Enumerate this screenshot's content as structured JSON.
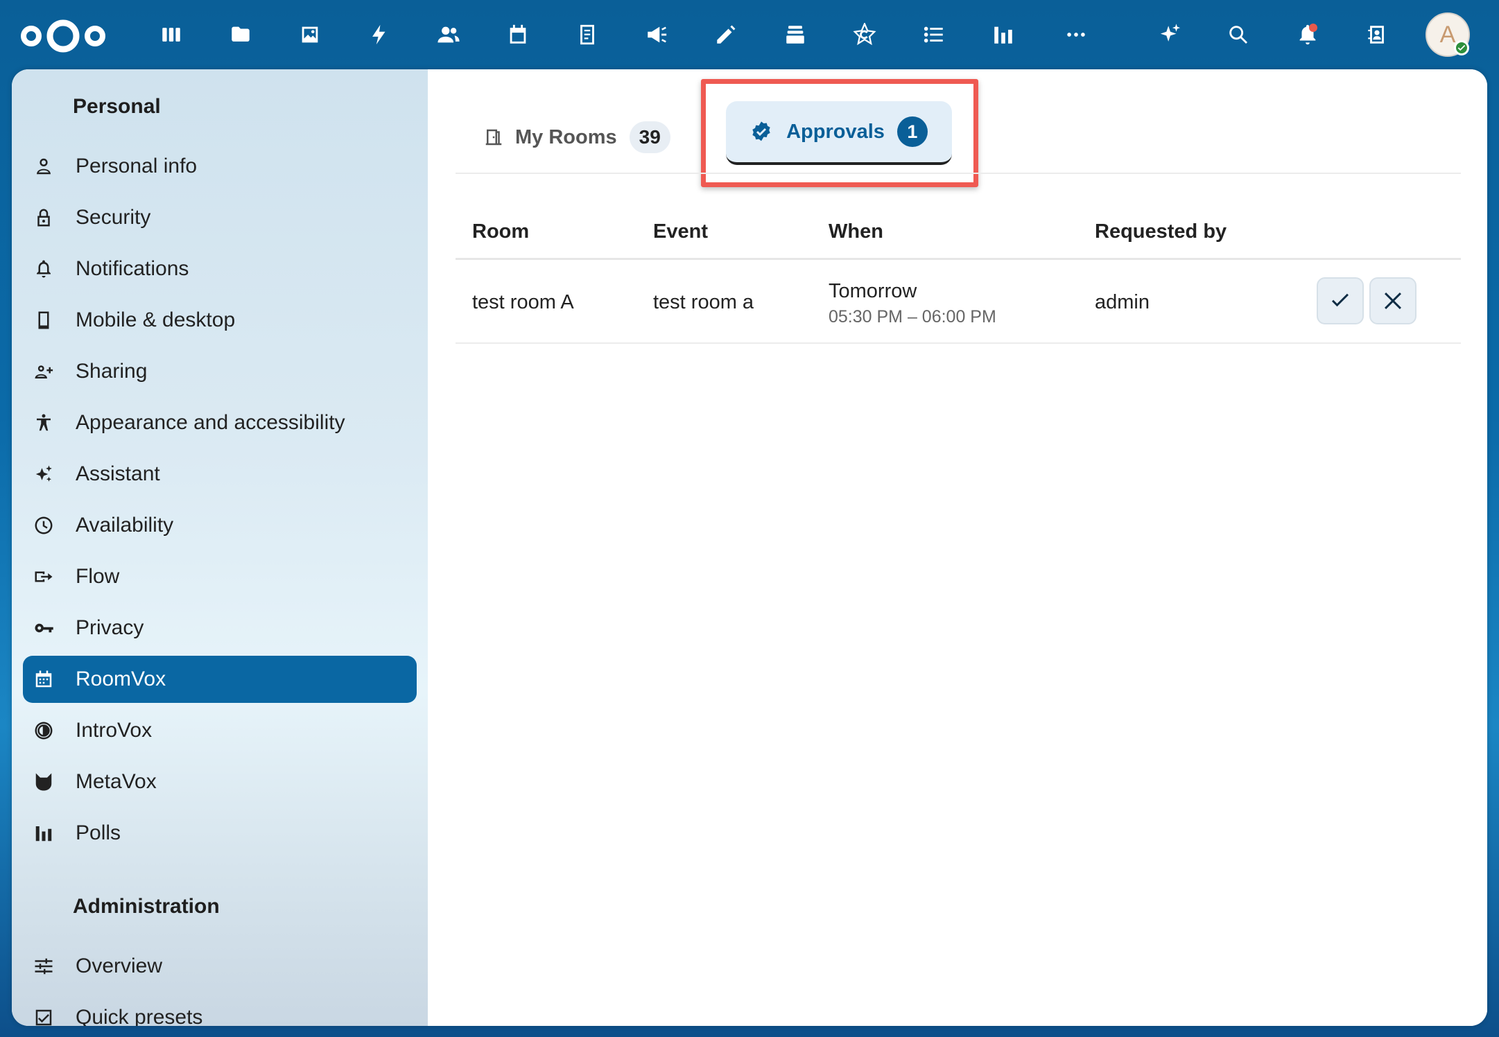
{
  "header": {
    "apps": [
      "dashboard-icon",
      "files-icon",
      "photos-icon",
      "activity-icon",
      "contacts-icon",
      "calendar-icon",
      "notes-icon",
      "announcements-icon",
      "edit-icon",
      "deck-icon",
      "circle-icon",
      "tasks-icon",
      "polls-icon",
      "more-icon"
    ],
    "avatar_letter": "A"
  },
  "sidebar": {
    "personal_title": "Personal",
    "items": [
      {
        "label": "Personal info",
        "icon": "person-icon"
      },
      {
        "label": "Security",
        "icon": "lock-icon"
      },
      {
        "label": "Notifications",
        "icon": "bell-icon"
      },
      {
        "label": "Mobile & desktop",
        "icon": "phone-icon"
      },
      {
        "label": "Sharing",
        "icon": "share-icon"
      },
      {
        "label": "Appearance and accessibility",
        "icon": "accessibility-icon"
      },
      {
        "label": "Assistant",
        "icon": "sparkle-icon"
      },
      {
        "label": "Availability",
        "icon": "clock-icon"
      },
      {
        "label": "Flow",
        "icon": "flow-icon"
      },
      {
        "label": "Privacy",
        "icon": "key-icon"
      },
      {
        "label": "RoomVox",
        "icon": "calendar-grid-icon",
        "active": true
      },
      {
        "label": "IntroVox",
        "icon": "introvox-icon"
      },
      {
        "label": "MetaVox",
        "icon": "cat-icon"
      },
      {
        "label": "Polls",
        "icon": "bar-chart-icon"
      }
    ],
    "admin_title": "Administration",
    "admin_items": [
      {
        "label": "Overview",
        "icon": "sliders-icon"
      },
      {
        "label": "Quick presets",
        "icon": "checkbox-icon"
      }
    ]
  },
  "tabs": {
    "my_rooms": {
      "label": "My Rooms",
      "count": "39"
    },
    "approvals": {
      "label": "Approvals",
      "count": "1"
    }
  },
  "table": {
    "headers": {
      "room": "Room",
      "event": "Event",
      "when": "When",
      "requested_by": "Requested by"
    },
    "rows": [
      {
        "room": "test room A",
        "event": "test room a",
        "when_day": "Tomorrow",
        "when_time": "05:30 PM – 06:00 PM",
        "requested_by": "admin"
      }
    ]
  },
  "colors": {
    "accent": "#0a67a3",
    "highlight": "#ef5a52"
  }
}
